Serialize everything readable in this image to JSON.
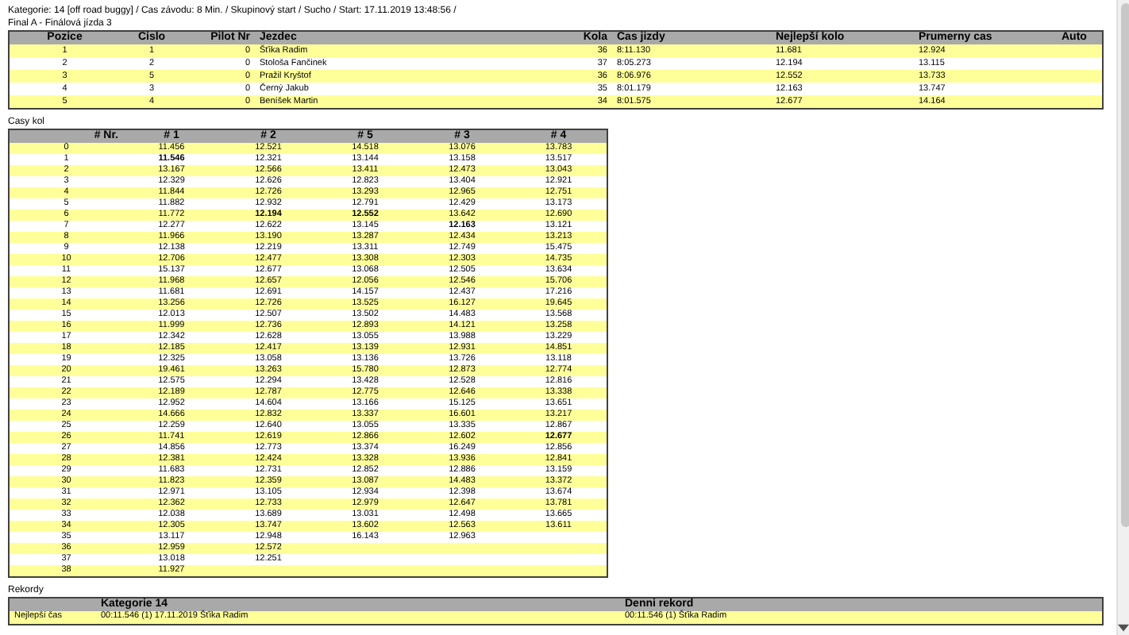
{
  "header": {
    "race_info": "Kategorie: 14 [off road buggy] / Cas závodu: 8 Min. / Skupinový start / Sucho / Start: 17.11.2019 13:48:56 /",
    "heat_title": "Final A - Finálová jízda 3"
  },
  "results": {
    "columns": [
      "Pozice",
      "Cislo",
      "Pilot Nr",
      "Jezdec",
      "Kola",
      "Cas jizdy",
      "Nejlepší kolo",
      "Prumerny cas",
      "Auto"
    ],
    "rows": [
      [
        "1",
        "1",
        "0",
        "Šťika Radim",
        "36",
        "8:11.130",
        "11.681",
        "12.924"
      ],
      [
        "2",
        "2",
        "0",
        "Stološa Fančinek",
        "37",
        "8:05.273",
        "12.194",
        "13.115"
      ],
      [
        "3",
        "5",
        "0",
        "Pražil Kryštof",
        "36",
        "8:06.976",
        "12.552",
        "13.733"
      ],
      [
        "4",
        "3",
        "0",
        "Černý Jakub",
        "35",
        "8:01.179",
        "12.163",
        "13.747"
      ],
      [
        "5",
        "4",
        "0",
        "Beníšek Martin",
        "34",
        "8:01.575",
        "12.677",
        "14.164"
      ]
    ]
  },
  "laps": {
    "title": "Casy kol",
    "columns": [
      "# Nr.",
      "# 1",
      "# 2",
      "# 5",
      "# 3",
      "# 4"
    ],
    "rows": [
      {
        "nr": "0",
        "times": [
          "11.456",
          "12.521",
          "14.518",
          "13.076",
          "13.783"
        ],
        "best": [
          false,
          false,
          false,
          false,
          false
        ]
      },
      {
        "nr": "1",
        "times": [
          "11.546",
          "12.321",
          "13.144",
          "13.158",
          "13.517"
        ],
        "best": [
          true,
          false,
          false,
          false,
          false
        ]
      },
      {
        "nr": "2",
        "times": [
          "13.167",
          "12.566",
          "13.411",
          "12.473",
          "13.043"
        ],
        "best": [
          false,
          false,
          false,
          false,
          false
        ]
      },
      {
        "nr": "3",
        "times": [
          "12.329",
          "12.626",
          "12.823",
          "13.404",
          "12.921"
        ],
        "best": [
          false,
          false,
          false,
          false,
          false
        ]
      },
      {
        "nr": "4",
        "times": [
          "11.844",
          "12.726",
          "13.293",
          "12.965",
          "12.751"
        ],
        "best": [
          false,
          false,
          false,
          false,
          false
        ]
      },
      {
        "nr": "5",
        "times": [
          "11.882",
          "12.932",
          "12.791",
          "12.429",
          "13.173"
        ],
        "best": [
          false,
          false,
          false,
          false,
          false
        ]
      },
      {
        "nr": "6",
        "times": [
          "11.772",
          "12.194",
          "12.552",
          "13.642",
          "12.690"
        ],
        "best": [
          false,
          true,
          true,
          false,
          false
        ]
      },
      {
        "nr": "7",
        "times": [
          "12.277",
          "12.622",
          "13.145",
          "12.163",
          "13.121"
        ],
        "best": [
          false,
          false,
          false,
          true,
          false
        ]
      },
      {
        "nr": "8",
        "times": [
          "11.966",
          "13.190",
          "13.287",
          "12.434",
          "13.213"
        ],
        "best": [
          false,
          false,
          false,
          false,
          false
        ]
      },
      {
        "nr": "9",
        "times": [
          "12.138",
          "12.219",
          "13.311",
          "12.749",
          "15.475"
        ],
        "best": [
          false,
          false,
          false,
          false,
          false
        ]
      },
      {
        "nr": "10",
        "times": [
          "12.706",
          "12.477",
          "13.308",
          "12.303",
          "14.735"
        ],
        "best": [
          false,
          false,
          false,
          false,
          false
        ]
      },
      {
        "nr": "11",
        "times": [
          "15.137",
          "12.677",
          "13.068",
          "12.505",
          "13.634"
        ],
        "best": [
          false,
          false,
          false,
          false,
          false
        ]
      },
      {
        "nr": "12",
        "times": [
          "11.968",
          "12.657",
          "12.056",
          "12.546",
          "15.706"
        ],
        "best": [
          false,
          false,
          false,
          false,
          false
        ]
      },
      {
        "nr": "13",
        "times": [
          "11.681",
          "12.691",
          "14.157",
          "12.437",
          "17.216"
        ],
        "best": [
          false,
          false,
          false,
          false,
          false
        ]
      },
      {
        "nr": "14",
        "times": [
          "13.256",
          "12.726",
          "13.525",
          "16.127",
          "19.645"
        ],
        "best": [
          false,
          false,
          false,
          false,
          false
        ]
      },
      {
        "nr": "15",
        "times": [
          "12.013",
          "12.507",
          "13.502",
          "14.483",
          "13.568"
        ],
        "best": [
          false,
          false,
          false,
          false,
          false
        ]
      },
      {
        "nr": "16",
        "times": [
          "11.999",
          "12.736",
          "12.893",
          "14.121",
          "13.258"
        ],
        "best": [
          false,
          false,
          false,
          false,
          false
        ]
      },
      {
        "nr": "17",
        "times": [
          "12.342",
          "12.628",
          "13.055",
          "13.988",
          "13.229"
        ],
        "best": [
          false,
          false,
          false,
          false,
          false
        ]
      },
      {
        "nr": "18",
        "times": [
          "12.185",
          "12.417",
          "13.139",
          "12.931",
          "14.851"
        ],
        "best": [
          false,
          false,
          false,
          false,
          false
        ]
      },
      {
        "nr": "19",
        "times": [
          "12.325",
          "13.058",
          "13.136",
          "13.726",
          "13.118"
        ],
        "best": [
          false,
          false,
          false,
          false,
          false
        ]
      },
      {
        "nr": "20",
        "times": [
          "19.461",
          "13.263",
          "15.780",
          "12.873",
          "12.774"
        ],
        "best": [
          false,
          false,
          false,
          false,
          false
        ]
      },
      {
        "nr": "21",
        "times": [
          "12.575",
          "12.294",
          "13.428",
          "12.528",
          "12.816"
        ],
        "best": [
          false,
          false,
          false,
          false,
          false
        ]
      },
      {
        "nr": "22",
        "times": [
          "12.189",
          "12.787",
          "12.775",
          "12.646",
          "13.338"
        ],
        "best": [
          false,
          false,
          false,
          false,
          false
        ]
      },
      {
        "nr": "23",
        "times": [
          "12.952",
          "14.604",
          "13.166",
          "15.125",
          "13.651"
        ],
        "best": [
          false,
          false,
          false,
          false,
          false
        ]
      },
      {
        "nr": "24",
        "times": [
          "14.666",
          "12.832",
          "13.337",
          "16.601",
          "13.217"
        ],
        "best": [
          false,
          false,
          false,
          false,
          false
        ]
      },
      {
        "nr": "25",
        "times": [
          "12.259",
          "12.640",
          "13.055",
          "13.335",
          "12.867"
        ],
        "best": [
          false,
          false,
          false,
          false,
          false
        ]
      },
      {
        "nr": "26",
        "times": [
          "11.741",
          "12.619",
          "12.866",
          "12.602",
          "12.677"
        ],
        "best": [
          false,
          false,
          false,
          false,
          true
        ]
      },
      {
        "nr": "27",
        "times": [
          "14.856",
          "12.773",
          "13.374",
          "16.249",
          "12.856"
        ],
        "best": [
          false,
          false,
          false,
          false,
          false
        ]
      },
      {
        "nr": "28",
        "times": [
          "12.381",
          "12.424",
          "13.328",
          "13.936",
          "12.841"
        ],
        "best": [
          false,
          false,
          false,
          false,
          false
        ]
      },
      {
        "nr": "29",
        "times": [
          "11.683",
          "12.731",
          "12.852",
          "12.886",
          "13.159"
        ],
        "best": [
          false,
          false,
          false,
          false,
          false
        ]
      },
      {
        "nr": "30",
        "times": [
          "11.823",
          "12.359",
          "13.087",
          "14.483",
          "13.372"
        ],
        "best": [
          false,
          false,
          false,
          false,
          false
        ]
      },
      {
        "nr": "31",
        "times": [
          "12.971",
          "13.105",
          "12.934",
          "12.398",
          "13.674"
        ],
        "best": [
          false,
          false,
          false,
          false,
          false
        ]
      },
      {
        "nr": "32",
        "times": [
          "12.362",
          "12.733",
          "12.979",
          "12.647",
          "13.781"
        ],
        "best": [
          false,
          false,
          false,
          false,
          false
        ]
      },
      {
        "nr": "33",
        "times": [
          "12.038",
          "13.689",
          "13.031",
          "12.498",
          "13.665"
        ],
        "best": [
          false,
          false,
          false,
          false,
          false
        ]
      },
      {
        "nr": "34",
        "times": [
          "12.305",
          "13.747",
          "13.602",
          "12.563",
          "13.611"
        ],
        "best": [
          false,
          false,
          false,
          false,
          false
        ]
      },
      {
        "nr": "35",
        "times": [
          "13.117",
          "12.948",
          "16.143",
          "12.963"
        ],
        "best": [
          false,
          false,
          false,
          false
        ]
      },
      {
        "nr": "36",
        "times": [
          "12.959",
          "12.572"
        ],
        "best": [
          false,
          false
        ]
      },
      {
        "nr": "37",
        "times": [
          "13.018",
          "12.251"
        ],
        "best": [
          false,
          false
        ]
      },
      {
        "nr": "38",
        "times": [
          "11.927"
        ],
        "best": [
          false
        ]
      }
    ]
  },
  "records": {
    "title": "Rekordy",
    "columns": [
      "Kategorie 14",
      "Denni rekord"
    ],
    "rows": [
      {
        "label": "Nejlepší čas",
        "category": "00:11.546 (1) 17.11.2019 Šťika Radim",
        "daily": "00:11.546 (1) Šťika Radim"
      }
    ]
  }
}
